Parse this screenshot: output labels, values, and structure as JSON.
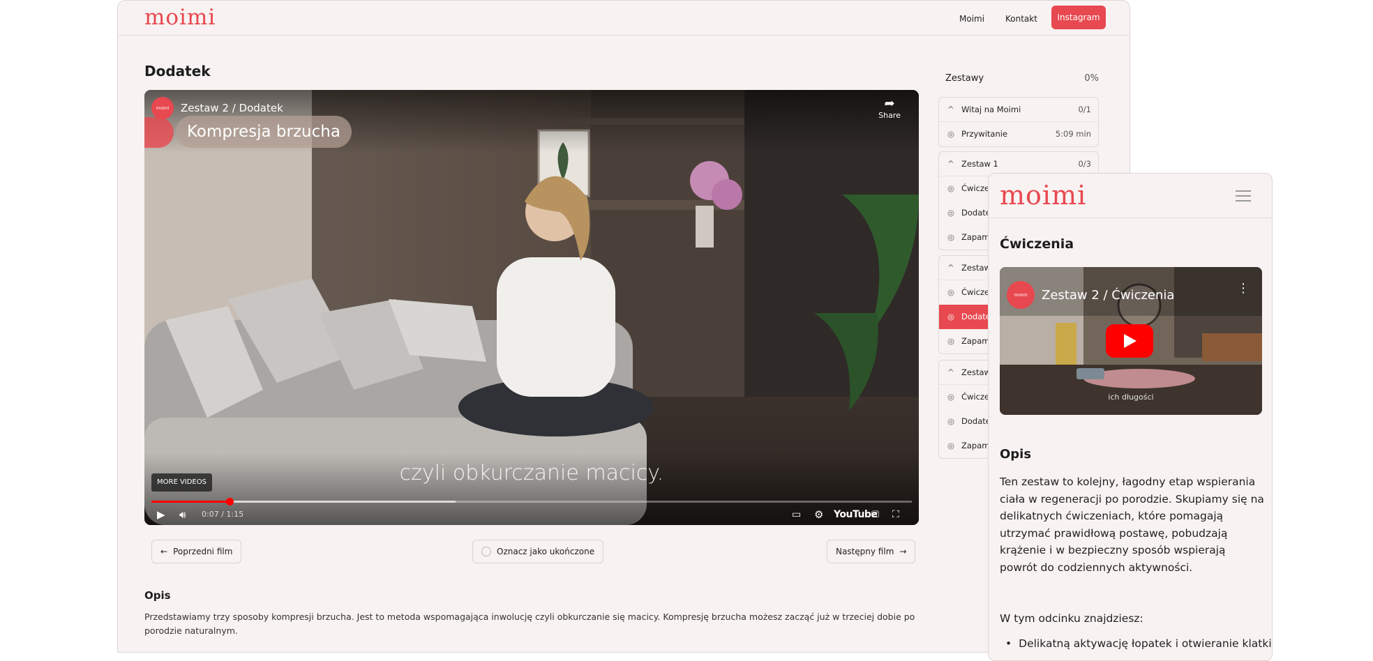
{
  "header": {
    "logo": "moimi",
    "nav": [
      "Moimi",
      "Kontakt"
    ],
    "cta": "Instagram"
  },
  "main": {
    "title": "Dodatek",
    "video": {
      "channel_avatar": "moimi",
      "title": "Zestaw 2 / Dodatek",
      "share_label": "Share",
      "overlay_title": "Kompresja brzucha",
      "caption": "czyli obkurczanie macicy.",
      "more_videos": "MORE VIDEOS",
      "time": "0:07 / 1:15",
      "progress": 0.103,
      "buffered": 0.4,
      "youtube_label": "YouTube"
    },
    "prev_label": "Poprzedni film",
    "complete_label": "Oznacz jako ukończone",
    "next_label": "Następny film",
    "desc_heading": "Opis",
    "desc_text": "Przedstawiamy trzy sposoby kompresji brzucha. Jest to metoda wspomagająca inwolucję czyli obkurczanie się macicy. Kompresję brzucha możesz zacząć już w trzeciej dobie po porodzie naturalnym."
  },
  "sidebar": {
    "heading": "Zestawy",
    "percent": "0%",
    "groups": [
      {
        "title": "Witaj na Moimi",
        "count": "0/1",
        "items": [
          {
            "label": "Przywitanie",
            "duration": "5:09 min"
          }
        ]
      },
      {
        "title": "Zestaw 1",
        "count": "0/3",
        "items": [
          {
            "label": "Ćwicze"
          },
          {
            "label": "Dodate"
          },
          {
            "label": "Zapami"
          }
        ]
      },
      {
        "title": "Zestaw",
        "items": [
          {
            "label": "Ćwicze"
          },
          {
            "label": "Dodate"
          },
          {
            "label": "Zapami"
          }
        ]
      },
      {
        "title": "Zestaw",
        "items": [
          {
            "label": "Ćwicze"
          },
          {
            "label": "Dodate"
          },
          {
            "label": "Zapami"
          }
        ]
      }
    ]
  },
  "mobile": {
    "logo": "moimi",
    "title": "Ćwiczenia",
    "video_avatar": "moimi",
    "video_title": "Zestaw 2 / Ćwiczenia",
    "video_caption": "ich długości",
    "desc_heading": "Opis",
    "desc_text": "Ten zestaw to kolejny, łagodny etap wspierania ciała w regeneracji po porodzie. Skupiamy się na delikatnych ćwiczeniach, które pomagają utrzymać prawidłową postawę, pobudzają krążenie i w bezpieczny sposób wspierają powrót do codziennych aktywności.",
    "episode_intro": "W tym odcinku znajdziesz:",
    "list_item": "Delikatną aktywację łopatek i otwieranie klatki"
  }
}
